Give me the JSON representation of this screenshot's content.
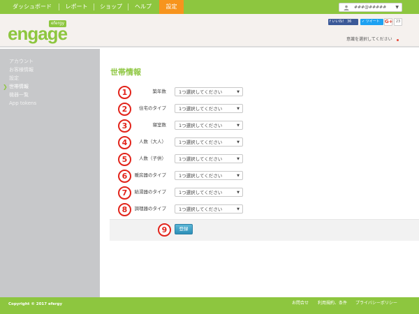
{
  "topnav": {
    "items": [
      {
        "label": "ダッシュボード"
      },
      {
        "label": "レポート"
      },
      {
        "label": "ショップ"
      },
      {
        "label": "ヘルプ"
      },
      {
        "label": "設定"
      }
    ],
    "active_index": 4,
    "account_name": "###@#####",
    "colors": {
      "nav": "#8dc63f",
      "active": "#f7941d"
    }
  },
  "header": {
    "logo_text": "engage",
    "logo_tag": "efergy",
    "social": {
      "like_label": "いいね！ 36",
      "tweet_label": "ツイート",
      "gplus_label": "G+",
      "gplus_count": "23"
    },
    "store_select_text": "意識を選択してください"
  },
  "sidebar": {
    "items": [
      {
        "label": "アカウント"
      },
      {
        "label": "お客様情報"
      },
      {
        "label": "設定"
      },
      {
        "label": "世帯情報"
      },
      {
        "label": "機器一覧"
      },
      {
        "label": "App tokens"
      }
    ],
    "active_index": 3
  },
  "main": {
    "title": "世帯情報",
    "fields": [
      {
        "number": "1",
        "label": "築年数",
        "value": "1つ選択してください"
      },
      {
        "number": "2",
        "label": "住宅のタイプ",
        "value": "1つ選択してください"
      },
      {
        "number": "3",
        "label": "寝室数",
        "value": "1つ選択してください"
      },
      {
        "number": "4",
        "label": "人数（大人）",
        "value": "1つ選択してください"
      },
      {
        "number": "5",
        "label": "人数（子供）",
        "value": "1つ選択してください"
      },
      {
        "number": "6",
        "label": "暖房器のタイプ",
        "value": "1つ選択してください"
      },
      {
        "number": "7",
        "label": "給湯器のタイプ",
        "value": "1つ選択してください"
      },
      {
        "number": "8",
        "label": "調理器のタイプ",
        "value": "1つ選択してください"
      }
    ],
    "submit_number": "9",
    "submit_label": "登録"
  },
  "footer": {
    "copyright": "Copyright © 2017 efergy",
    "links": [
      {
        "label": "お問合せ"
      },
      {
        "label": "利用規約、条件"
      },
      {
        "label": "プライバシーポリシー"
      }
    ]
  },
  "colors": {
    "brand_green": "#8dc63f",
    "annotation_red": "#e2231a",
    "button_blue": "#2c8fb8"
  }
}
